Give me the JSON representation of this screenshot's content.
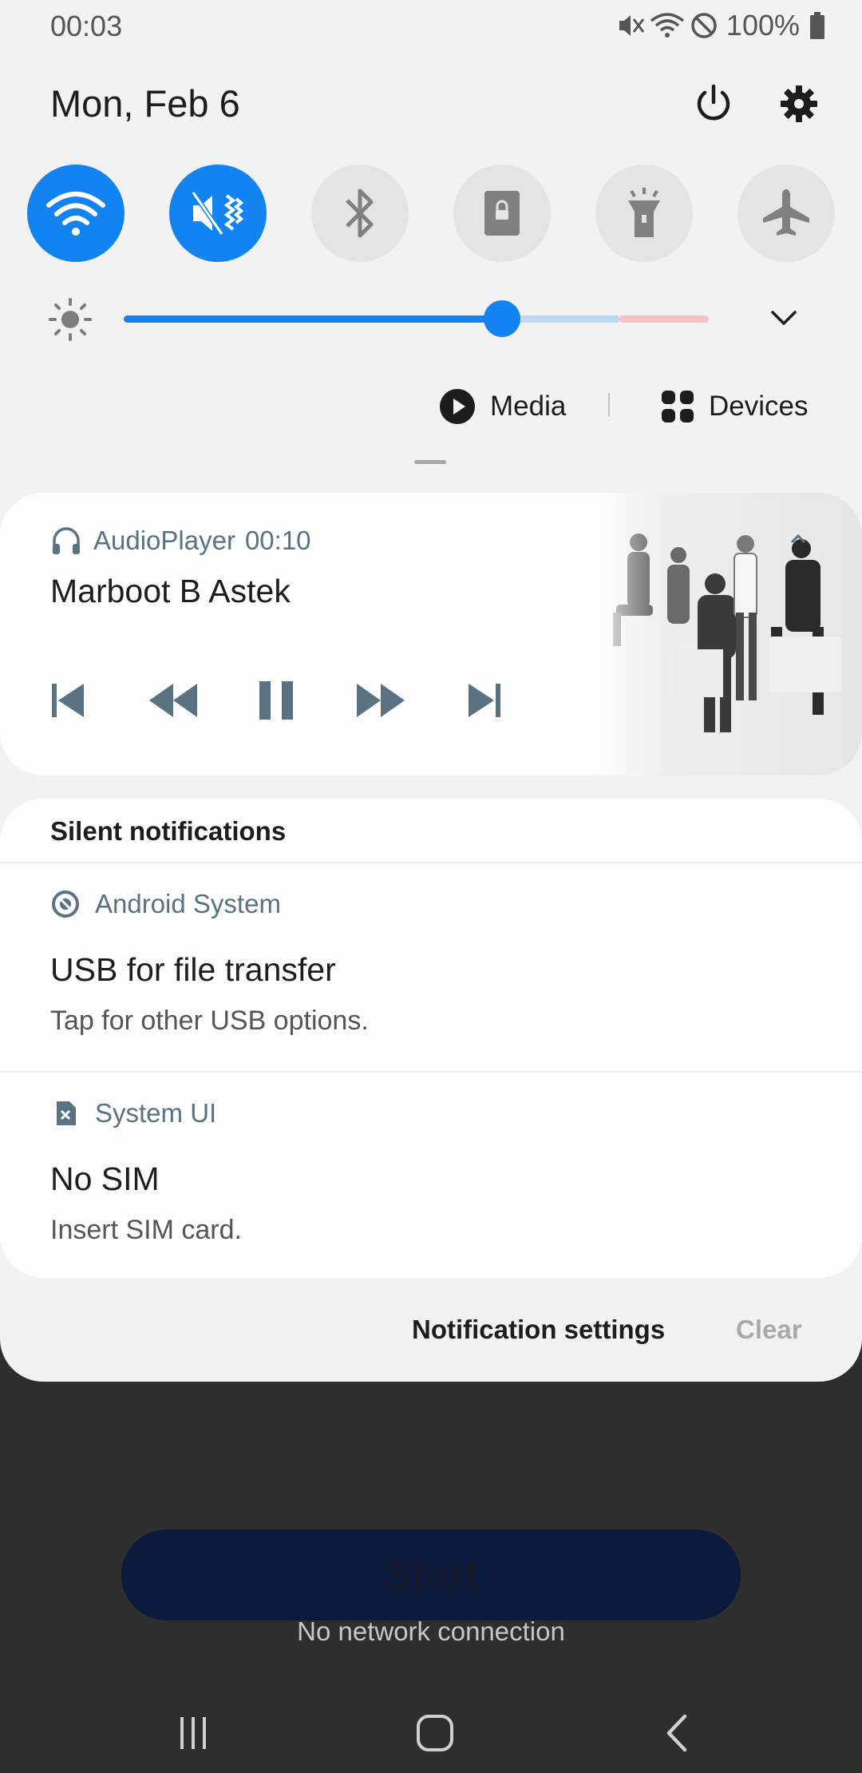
{
  "status_bar": {
    "time": "00:03",
    "battery_percent": "100%",
    "icons": [
      "vibrate-off-icon",
      "wifi-icon",
      "do-not-disturb-icon",
      "battery-icon"
    ]
  },
  "header": {
    "date": "Mon, Feb 6",
    "power_icon": "power-icon",
    "settings_icon": "gear-icon"
  },
  "quick_settings": [
    {
      "name": "wifi",
      "icon": "wifi-icon",
      "on": true
    },
    {
      "name": "sound",
      "icon": "mute-icon",
      "on": true
    },
    {
      "name": "bluetooth",
      "icon": "bluetooth-icon",
      "on": false
    },
    {
      "name": "rotation-lock",
      "icon": "lock-icon",
      "on": false
    },
    {
      "name": "flashlight",
      "icon": "flashlight-icon",
      "on": false
    },
    {
      "name": "airplane-mode",
      "icon": "airplane-icon",
      "on": false
    }
  ],
  "brightness": {
    "level": 0.65
  },
  "media_bar": {
    "media_label": "Media",
    "devices_label": "Devices"
  },
  "media_card": {
    "app_name": "AudioPlayer",
    "elapsed": "00:10",
    "title": "Marboot B Astek"
  },
  "silent": {
    "heading": "Silent notifications",
    "items": [
      {
        "source": "Android System",
        "title": "USB for file transfer",
        "subtitle": "Tap for other USB options."
      },
      {
        "source": "System UI",
        "title": "No SIM",
        "subtitle": "Insert SIM card."
      }
    ]
  },
  "footer": {
    "settings_label": "Notification settings",
    "clear_label": "Clear"
  },
  "background_app": {
    "start_label": "Start",
    "status": "No network connection"
  },
  "colors": {
    "accent": "#1283f1",
    "panel": "#f2f2f2",
    "card": "#fdfdfd",
    "secondary_text": "#5b7282"
  }
}
